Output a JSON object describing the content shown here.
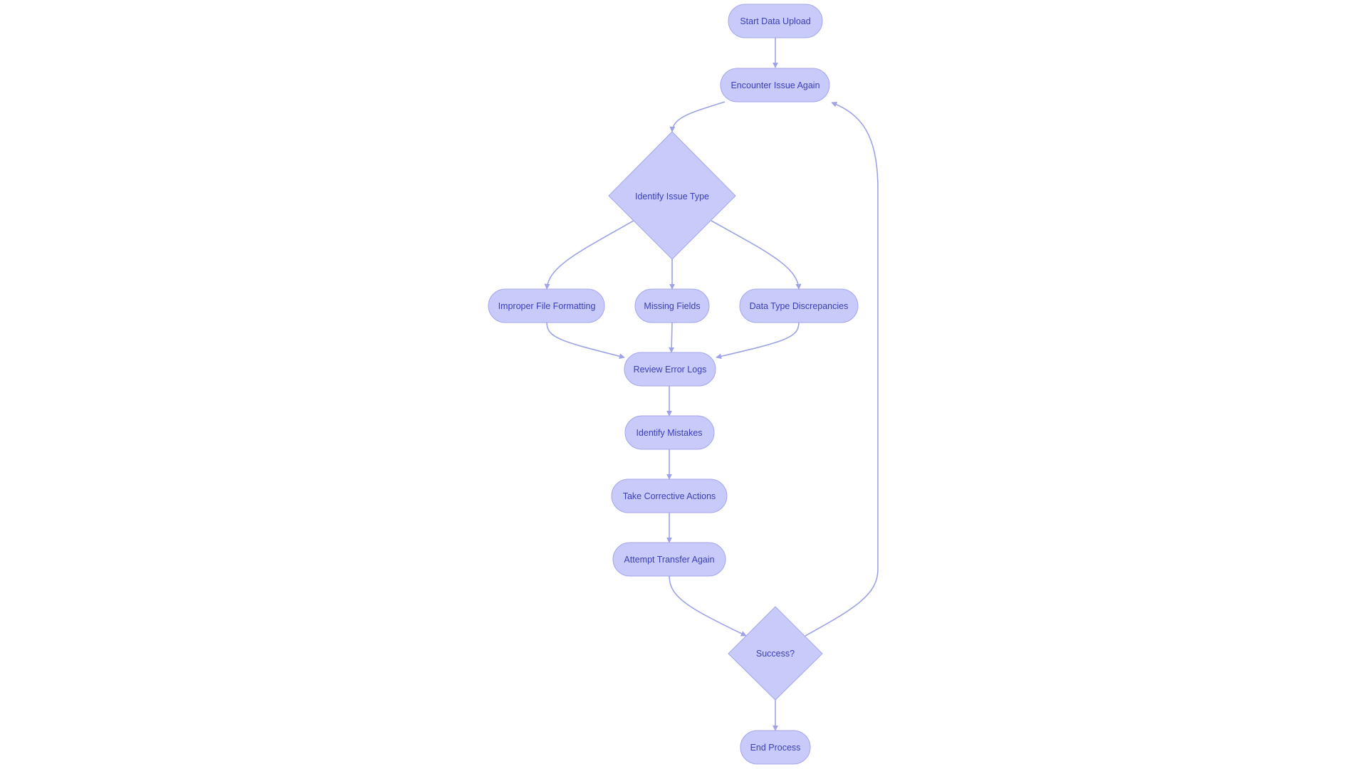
{
  "colors": {
    "node_fill": "#c8cafa",
    "node_stroke": "#a3a6ea",
    "text": "#3a3fb8",
    "edge": "#9ea2e6",
    "background": "#ffffff"
  },
  "nodes": {
    "start": {
      "label": "Start Data Upload",
      "shape": "rounded"
    },
    "encounter": {
      "label": "Encounter Issue Again",
      "shape": "rounded"
    },
    "identify_type": {
      "label": "Identify Issue Type",
      "shape": "diamond"
    },
    "improper": {
      "label": "Improper File Formatting",
      "shape": "rounded"
    },
    "missing": {
      "label": "Missing Fields",
      "shape": "rounded"
    },
    "datatype": {
      "label": "Data Type Discrepancies",
      "shape": "rounded"
    },
    "review": {
      "label": "Review Error Logs",
      "shape": "rounded"
    },
    "mistakes": {
      "label": "Identify Mistakes",
      "shape": "rounded"
    },
    "corrective": {
      "label": "Take Corrective Actions",
      "shape": "rounded"
    },
    "attempt": {
      "label": "Attempt Transfer Again",
      "shape": "rounded"
    },
    "success": {
      "label": "Success?",
      "shape": "diamond"
    },
    "end": {
      "label": "End Process",
      "shape": "rounded"
    }
  },
  "edges": [
    {
      "from": "start",
      "to": "encounter"
    },
    {
      "from": "encounter",
      "to": "identify_type"
    },
    {
      "from": "identify_type",
      "to": "improper"
    },
    {
      "from": "identify_type",
      "to": "missing"
    },
    {
      "from": "identify_type",
      "to": "datatype"
    },
    {
      "from": "improper",
      "to": "review"
    },
    {
      "from": "missing",
      "to": "review"
    },
    {
      "from": "datatype",
      "to": "review"
    },
    {
      "from": "review",
      "to": "mistakes"
    },
    {
      "from": "mistakes",
      "to": "corrective"
    },
    {
      "from": "corrective",
      "to": "attempt"
    },
    {
      "from": "attempt",
      "to": "success"
    },
    {
      "from": "success",
      "to": "encounter"
    },
    {
      "from": "success",
      "to": "end"
    }
  ]
}
